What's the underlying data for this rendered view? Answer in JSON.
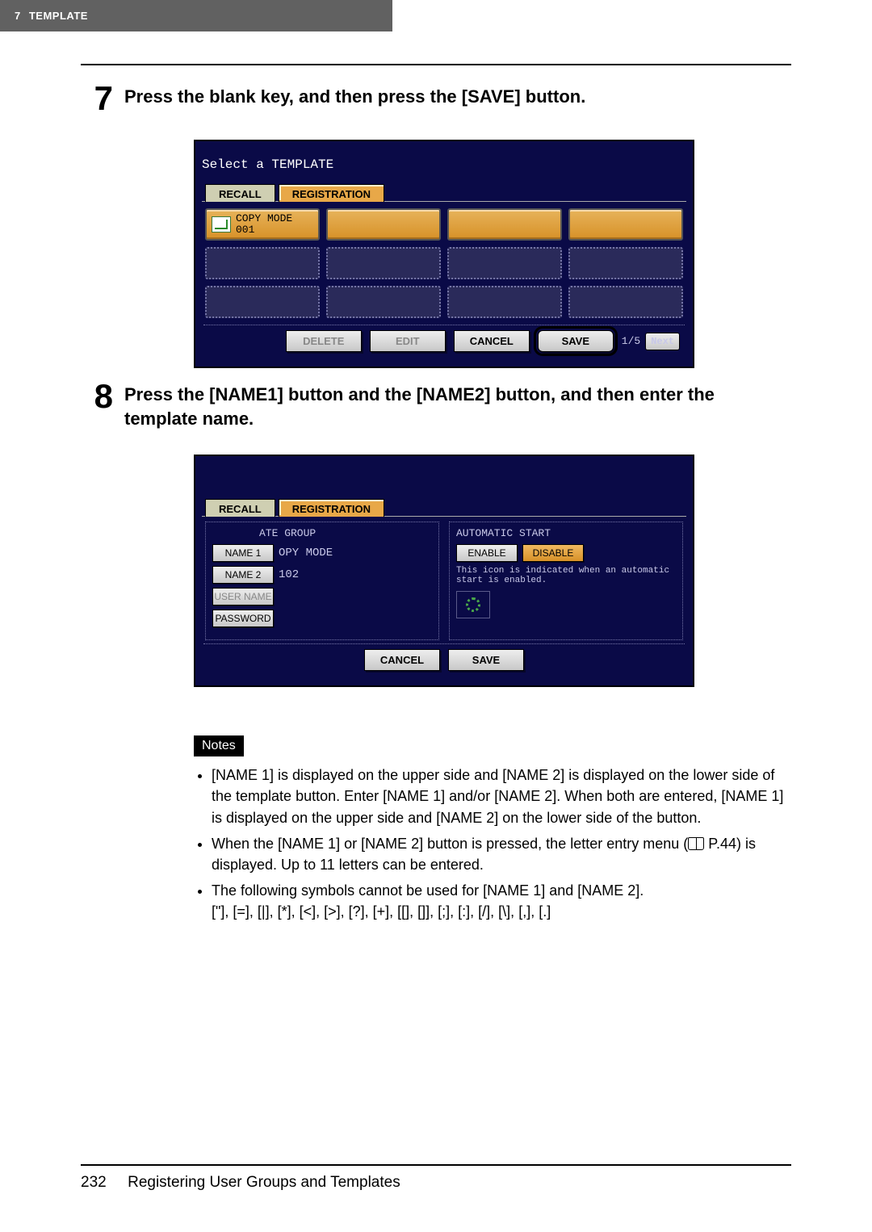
{
  "header": {
    "section_num": "7",
    "section_name": "TEMPLATE"
  },
  "steps": {
    "s7": {
      "num": "7",
      "text": "Press the blank key, and then press the [SAVE] button."
    },
    "s8": {
      "num": "8",
      "text": "Press the [NAME1] button and the [NAME2] button, and then enter the template name."
    }
  },
  "screen1": {
    "title": "Select a TEMPLATE",
    "tabs": {
      "recall": "RECALL",
      "registration": "REGISTRATION"
    },
    "template_cell": {
      "line1": "COPY MODE",
      "line2": "001"
    },
    "buttons": {
      "delete": "DELETE",
      "edit": "EDIT",
      "cancel": "CANCEL",
      "save": "SAVE",
      "next": "Next"
    },
    "page_counter": "1/5"
  },
  "screen2": {
    "tabs": {
      "recall": "RECALL",
      "registration": "REGISTRATION"
    },
    "left": {
      "group_frag": "ATE GROUP",
      "name1_label": "NAME 1",
      "name1_val": "OPY MODE",
      "name2_label": "NAME 2",
      "name2_val": "102",
      "user_label": "USER NAME",
      "password_label": "PASSWORD"
    },
    "right": {
      "title": "AUTOMATIC START",
      "enable": "ENABLE",
      "disable": "DISABLE",
      "hint": "This icon is indicated when an automatic\nstart is enabled."
    },
    "buttons": {
      "cancel": "CANCEL",
      "save": "SAVE"
    }
  },
  "notes": {
    "heading": "Notes",
    "items": [
      "[NAME 1] is displayed on the upper side and [NAME 2] is displayed on the lower side of the template button. Enter [NAME 1] and/or [NAME 2]. When both are entered, [NAME 1] is displayed on the upper side and [NAME 2] on the lower side of the button.",
      "",
      "The following symbols cannot be used for [NAME 1] and [NAME 2].\n[\"], [=], [|], [*], [<], [>], [?], [+], [[], []], [;], [:], [/], [\\], [,], [.]"
    ],
    "item2_pre": "When the [NAME 1] or [NAME 2] button is pressed, the letter entry menu (",
    "item2_ref": " P.44",
    "item2_post": ") is displayed. Up to 11 letters can be entered."
  },
  "footer": {
    "page_num": "232",
    "label": "Registering User Groups and Templates"
  }
}
